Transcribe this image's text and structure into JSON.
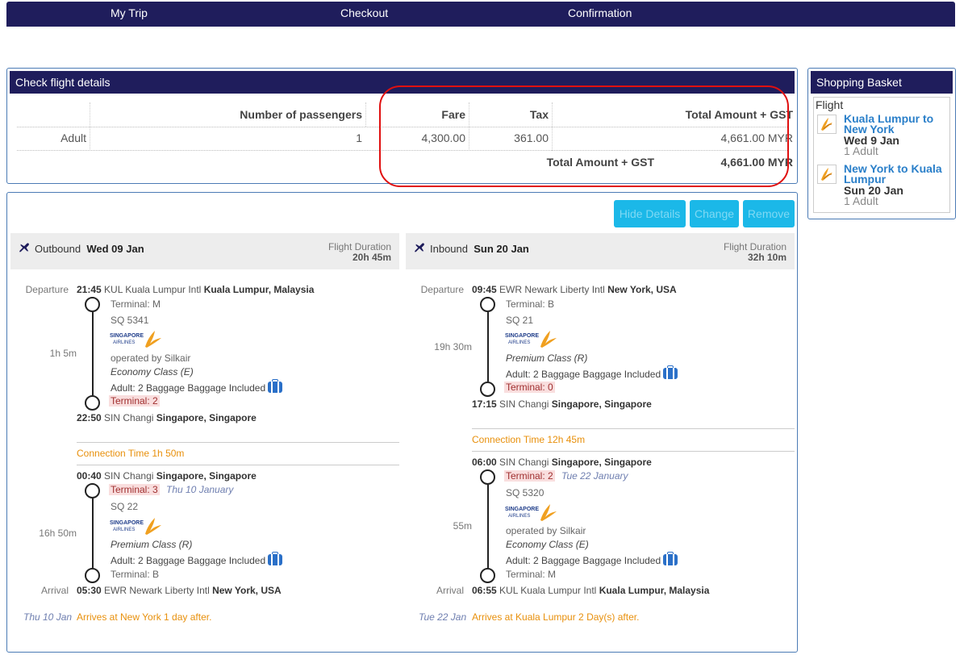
{
  "topnav": {
    "my_trip": "My Trip",
    "checkout": "Checkout",
    "confirmation": "Confirmation"
  },
  "check_details": {
    "title": "Check flight details",
    "headers": {
      "passengers": "Number of passengers",
      "fare": "Fare",
      "tax": "Tax",
      "total": "Total Amount + GST"
    },
    "row": {
      "type": "Adult",
      "passengers": "1",
      "fare": "4,300.00",
      "tax": "361.00",
      "total": "4,661.00 MYR"
    },
    "summary": {
      "label": "Total Amount + GST",
      "value": "4,661.00 MYR"
    }
  },
  "basket": {
    "title": "Shopping Basket",
    "flight_label": "Flight",
    "items": [
      {
        "route": "Kuala Lumpur to New York",
        "date": "Wed 9 Jan",
        "pax": "1 Adult"
      },
      {
        "route": "New York to Kuala Lumpur",
        "date": "Sun 20 Jan",
        "pax": "1 Adult"
      }
    ]
  },
  "buttons": {
    "hide": "Hide Details",
    "change": "Change",
    "remove": "Remove"
  },
  "outbound": {
    "dir_label": "Outbound",
    "date": "Wed 09 Jan",
    "duration_label": "Flight Duration",
    "duration": "20h 45m",
    "seg1": {
      "departure_label": "Departure",
      "dep_time": "21:45",
      "dep_airport": "KUL Kuala Lumpur Intl",
      "dep_city": "Kuala Lumpur, Malaysia",
      "dep_terminal": "Terminal: M",
      "flight_no": "SQ 5341",
      "operated": "operated by Silkair",
      "cabin": "Economy Class (E)",
      "baggage": "Adult: 2 Baggage Baggage Included",
      "arr_terminal": "Terminal: 2",
      "duration": "1h 5m",
      "arr_time": "22:50",
      "arr_airport": "SIN Changi",
      "arr_city": "Singapore, Singapore"
    },
    "connection": "Connection Time 1h 50m",
    "seg2": {
      "dep_time": "00:40",
      "dep_airport": "SIN Changi",
      "dep_city": "Singapore, Singapore",
      "dep_terminal": "Terminal: 3",
      "dep_date_note": "Thu 10 January",
      "flight_no": "SQ 22",
      "cabin": "Premium Class (R)",
      "baggage": "Adult: 2 Baggage Baggage Included",
      "arr_terminal": "Terminal: B",
      "duration": "16h 50m",
      "arrival_label": "Arrival",
      "arr_time": "05:30",
      "arr_airport": "EWR Newark Liberty Intl",
      "arr_city": "New York, USA"
    },
    "footer_date": "Thu 10 Jan",
    "footer_note": "Arrives at New York 1 day after."
  },
  "inbound": {
    "dir_label": "Inbound",
    "date": "Sun 20 Jan",
    "duration_label": "Flight Duration",
    "duration": "32h 10m",
    "seg1": {
      "departure_label": "Departure",
      "dep_time": "09:45",
      "dep_airport": "EWR Newark Liberty Intl",
      "dep_city": "New York, USA",
      "dep_terminal": "Terminal: B",
      "flight_no": "SQ 21",
      "cabin": "Premium Class (R)",
      "baggage": "Adult: 2 Baggage Baggage Included",
      "arr_terminal": "Terminal: 0",
      "duration": "19h 30m",
      "arr_time": "17:15",
      "arr_airport": "SIN Changi",
      "arr_city": "Singapore, Singapore"
    },
    "connection": "Connection Time 12h 45m",
    "seg2": {
      "dep_time": "06:00",
      "dep_airport": "SIN Changi",
      "dep_city": "Singapore, Singapore",
      "dep_terminal": "Terminal: 2",
      "dep_date_note": "Tue 22 January",
      "flight_no": "SQ 5320",
      "operated": "operated by Silkair",
      "cabin": "Economy Class (E)",
      "baggage": "Adult: 2 Baggage Baggage Included",
      "arr_terminal": "Terminal: M",
      "duration": "55m",
      "arrival_label": "Arrival",
      "arr_time": "06:55",
      "arr_airport": "KUL Kuala Lumpur Intl",
      "arr_city": "Kuala Lumpur, Malaysia"
    },
    "footer_date": "Tue 22 Jan",
    "footer_note": "Arrives at Kuala Lumpur 2 Day(s) after."
  },
  "colors": {
    "navy": "#1f1d5c",
    "button": "#1bb8e8",
    "link": "#2a7fc9",
    "orange": "#e8900c",
    "highlight_red": "#e01010"
  }
}
